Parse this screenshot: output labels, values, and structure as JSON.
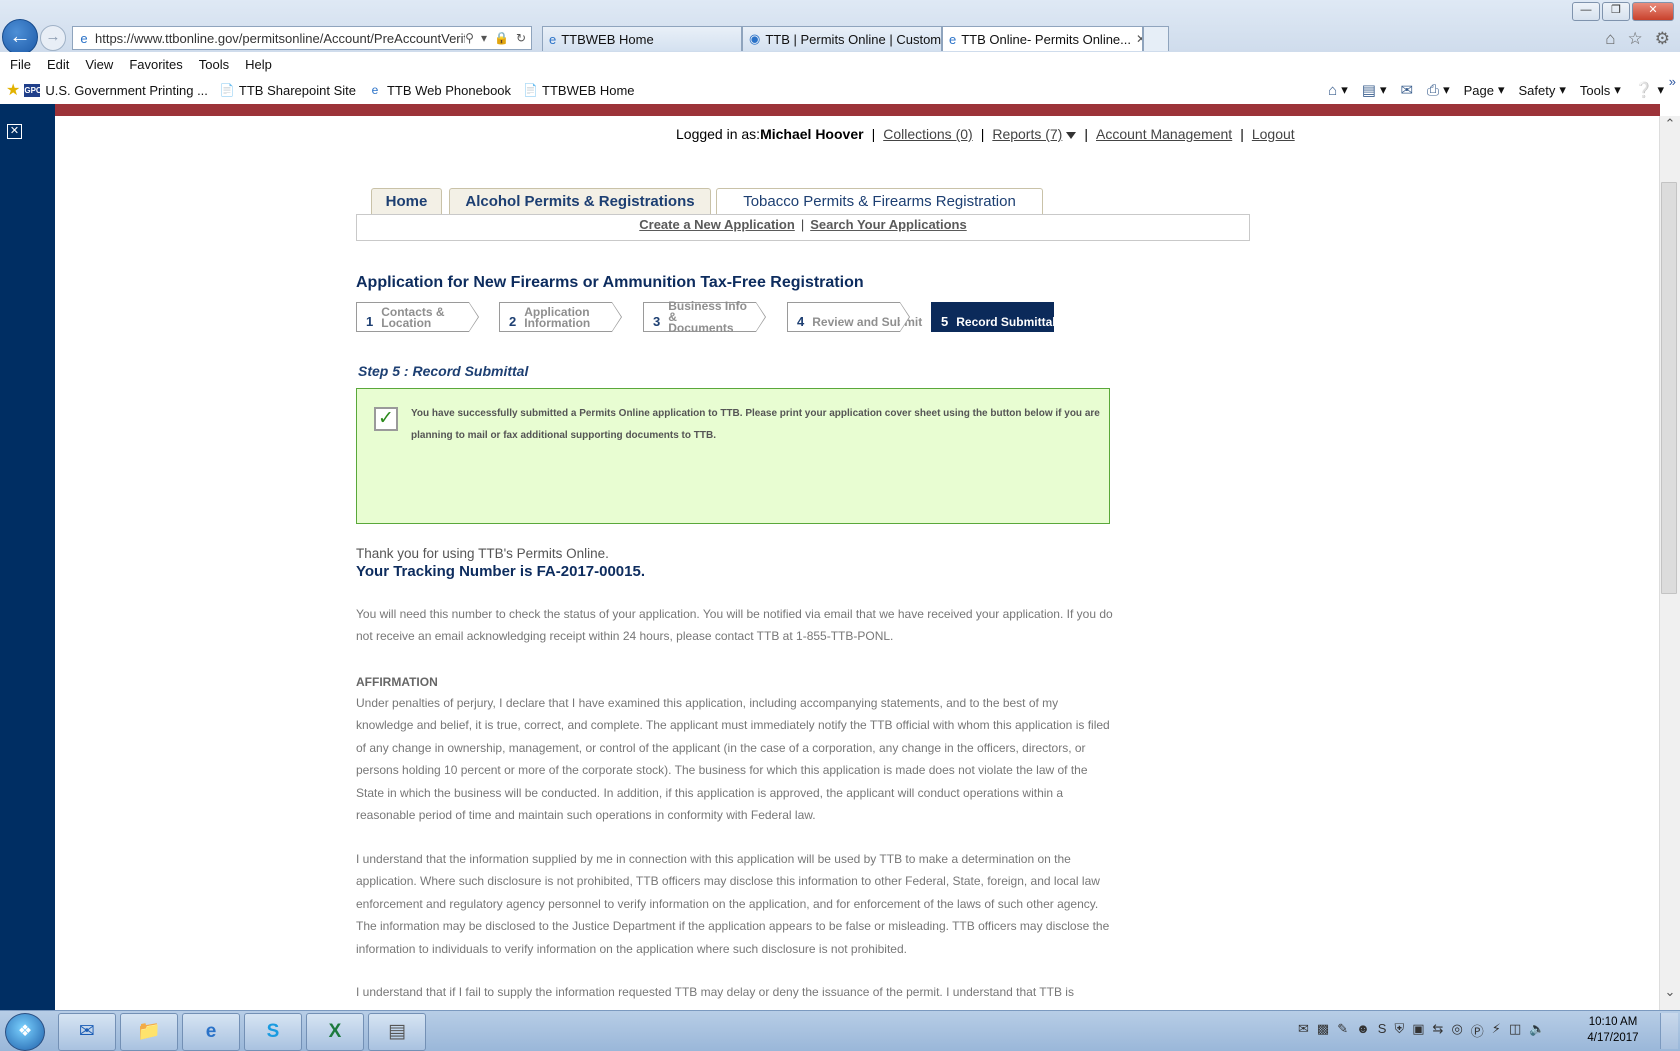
{
  "browser": {
    "url": "https://www.ttbonline.gov/permitsonline/Account/PreAccountVerific",
    "tabs": [
      {
        "title": "TTBWEB Home"
      },
      {
        "title": "TTB | Permits Online | Custom..."
      },
      {
        "title": "TTB Online- Permits Online..."
      }
    ],
    "menu": [
      "File",
      "Edit",
      "View",
      "Favorites",
      "Tools",
      "Help"
    ],
    "favorites": [
      "U.S. Government Printing ...",
      "TTB Sharepoint Site",
      "TTB Web Phonebook",
      "TTBWEB Home"
    ],
    "gpo_badge": "GPO",
    "commands": [
      "Page",
      "Safety",
      "Tools"
    ]
  },
  "user_bar": {
    "logged_in_prefix": "Logged in as:",
    "user_name": "Michael Hoover",
    "collections": "Collections (0)",
    "reports": "Reports (7)",
    "account_management": "Account Management",
    "logout": "Logout"
  },
  "nav_tabs": [
    {
      "label": "Home"
    },
    {
      "label": "Alcohol Permits & Registrations"
    },
    {
      "label": "Tobacco Permits & Firearms Registration"
    }
  ],
  "sub_nav": {
    "create": "Create a New Application",
    "search": "Search Your Applications"
  },
  "page_title": "Application for New Firearms or Ammunition Tax-Free Registration",
  "steps": [
    {
      "num": "1",
      "line1": "Contacts &",
      "line2": "Location"
    },
    {
      "num": "2",
      "line1": "Application",
      "line2": "Information"
    },
    {
      "num": "3",
      "line1": "Business Info &",
      "line2": "Documents"
    },
    {
      "num": "4",
      "line1": "Review and Submit",
      "line2": ""
    },
    {
      "num": "5",
      "line1": "Record Submittal",
      "line2": ""
    }
  ],
  "current_step": 5,
  "step_heading": "Step 5 : Record Submittal",
  "success_message": "You have successfully submitted a Permits Online application to TTB. Please print your application cover sheet using the button below if you are planning to mail or fax additional supporting documents to TTB.",
  "thanks": "Thank you for using TTB's Permits Online.",
  "tracking": "Your Tracking Number is FA-2017-00015.",
  "notice": "You will need this number to check the status of your application. You will be notified via email that we have received your application.  If you do not receive an email acknowledging receipt within 24 hours, please contact TTB at 1-855-TTB-PONL.",
  "affirmation_heading": "AFFIRMATION",
  "affirmation_p1": "Under penalties of perjury, I declare that I have examined this application, including accompanying statements, and to the best of my knowledge and belief, it is true, correct, and complete. The applicant must immediately notify the TTB official with whom this application is filed of any change in ownership, management, or control of the applicant (in the case of a corporation, any change in the officers, directors, or persons holding 10 percent or more of the corporate stock). The business for which this application is made does not violate the law of the State in which the business will be conducted. In addition, if this application is approved, the applicant will conduct operations within a reasonable period of time and maintain such operations in conformity with Federal law.",
  "affirmation_p2": "I understand that the information supplied by me in connection with this application will be used by TTB to make a determination on the application. Where such disclosure is not prohibited, TTB officers may disclose this information to other Federal, State, foreign, and local law enforcement and regulatory agency personnel to verify information on the application, and for enforcement of the laws of such other agency. The information may be disclosed to the Justice Department if the application appears to be false or misleading. TTB officers may disclose the information to individuals to verify information on the application where such disclosure is not prohibited.",
  "affirmation_p3": "I understand that if I fail to supply the information requested TTB may delay or deny the issuance of the permit.  I understand that TTB is",
  "clock": {
    "time": "10:10 AM",
    "date": "4/17/2017"
  },
  "colors": {
    "brand_red": "#9c3339",
    "nav_blue": "#002e63",
    "success_bg": "#e8fdd2",
    "success_border": "#5aa83a"
  }
}
